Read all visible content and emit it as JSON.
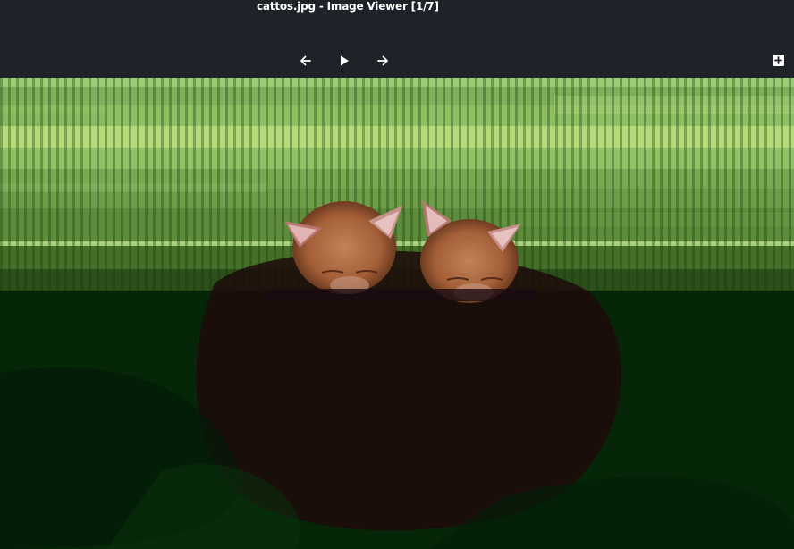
{
  "window": {
    "title": "cattos.jpg - Image Viewer [1/7]"
  },
  "toolbar": {
    "previous_icon": "arrow-left-icon",
    "play_icon": "play-icon",
    "next_icon": "arrow-right-icon",
    "fullscreen_icon": "fullscreen-icon"
  },
  "image": {
    "file_name": "cattos.jpg",
    "index": 1,
    "total": 7
  },
  "colors": {
    "background": "#202229",
    "foreground": "#ffffff"
  }
}
